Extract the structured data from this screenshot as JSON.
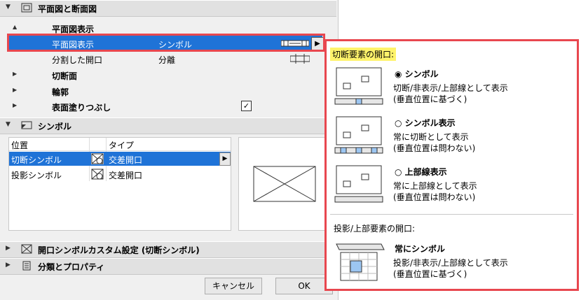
{
  "sections": {
    "floorplan_section": {
      "title": "平面図と断面図"
    },
    "symbol_section": {
      "title": "シンボル"
    },
    "custom_section": {
      "title": "開口シンボルカスタム設定 (切断シンボル)"
    },
    "class_section": {
      "title": "分類とプロパティ"
    }
  },
  "rows": {
    "display_group": "平面図表示",
    "display_row": {
      "name": "平面図表示",
      "value": "シンボル"
    },
    "split_row": {
      "name": "分割した開口",
      "value": "分離"
    },
    "cut_surface": "切断面",
    "outline": "輪郭",
    "fill": "表面塗りつぶし"
  },
  "symbol_table": {
    "col_position": "位置",
    "col_type": "タイプ",
    "rows": [
      {
        "position": "切断シンボル",
        "type": "交差開口"
      },
      {
        "position": "投影シンボル",
        "type": "交差開口"
      }
    ]
  },
  "buttons": {
    "cancel": "キャンセル",
    "ok": "OK"
  },
  "popup": {
    "cut_title": "切断要素の開口:",
    "options": [
      {
        "label": "シンボル",
        "line1": "切断/非表示/上部線として表示",
        "line2": "(垂直位置に基づく)",
        "selected": true
      },
      {
        "label": "シンボル表示",
        "line1": "常に切断として表示",
        "line2": "(垂直位置は問わない)",
        "selected": false
      },
      {
        "label": "上部線表示",
        "line1": "常に上部線として表示",
        "line2": "(垂直位置は問わない)",
        "selected": false
      }
    ],
    "proj_title": "投影/上部要素の開口:",
    "proj_option": {
      "label": "常にシンボル",
      "line1": "投影/非表示/上部線として表示",
      "line2": "(垂直位置に基づく)"
    }
  },
  "colors": {
    "selection": "#1f73d7",
    "highlight_border": "#e8474f",
    "title_highlight": "#fff36b"
  }
}
